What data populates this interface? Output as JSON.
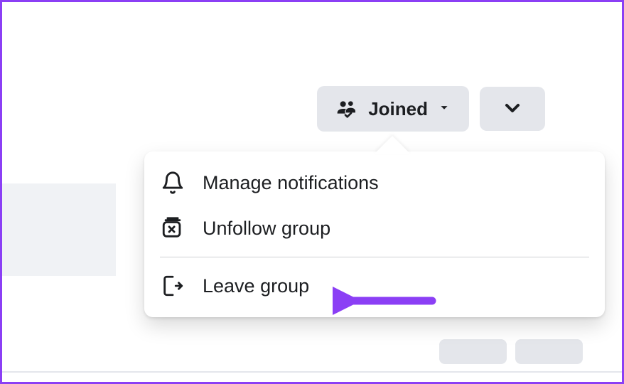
{
  "header": {
    "joined_label": "Joined"
  },
  "menu": {
    "manage_notifications": "Manage notifications",
    "unfollow_group": "Unfollow group",
    "leave_group": "Leave group"
  },
  "colors": {
    "accent": "#8b3ff5",
    "button_bg": "#e4e6eb",
    "text": "#1c1e21"
  }
}
